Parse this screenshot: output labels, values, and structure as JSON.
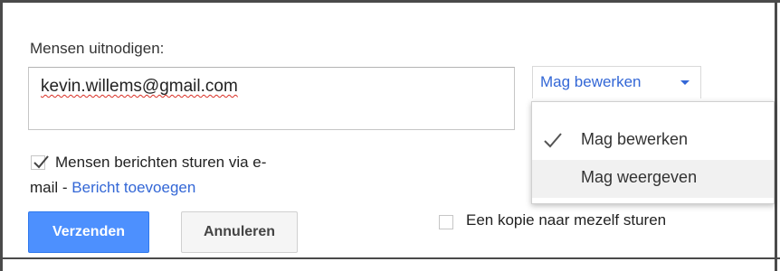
{
  "invite": {
    "label": "Mensen uitnodigen:",
    "value": "kevin.willems@gmail.com"
  },
  "permission": {
    "selected": "Mag bewerken",
    "accent_color": "#3367d6",
    "options": [
      {
        "label": "Mag bewerken",
        "checked": true,
        "icon": "checkmark-icon"
      },
      {
        "label": "Mag weergeven",
        "checked": false,
        "hovered": true
      }
    ]
  },
  "notify": {
    "checked": true,
    "line1": "Mensen berichten sturen via e-",
    "line2_prefix": "mail - ",
    "add_message_link": "Bericht toevoegen"
  },
  "actions": {
    "send_label": "Verzenden",
    "send_color": "#4d90fe",
    "cancel_label": "Annuleren"
  },
  "copy_to_self": {
    "checked": false,
    "label": "Een kopie naar mezelf sturen"
  }
}
